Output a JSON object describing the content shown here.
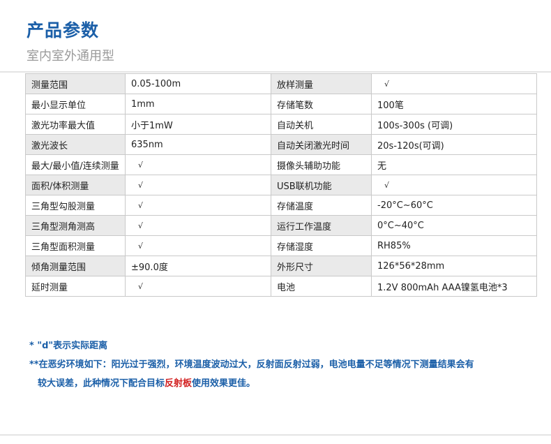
{
  "page": {
    "title": "产品参数",
    "subtitle": "室内室外通用型"
  },
  "spec_rows": [
    {
      "l1": "测量范围",
      "v1": "0.05-100m",
      "l2": "放样测量",
      "v2": "√",
      "shaded": true
    },
    {
      "l1": "最小显示单位",
      "v1": "1mm",
      "l2": "存储笔数",
      "v2": "100笔",
      "shaded": false
    },
    {
      "l1": "激光功率最大值",
      "v1": "小于1mW",
      "l2": "自动关机",
      "v2": "100s-300s (可调)",
      "shaded": false
    },
    {
      "l1": "激光波长",
      "v1": "635nm",
      "l2": "自动关闭激光时间",
      "v2": "20s-120s(可调)",
      "shaded": true
    },
    {
      "l1": "最大/最小值/连续测量",
      "v1": "√",
      "l2": "摄像头辅助功能",
      "v2": "无",
      "shaded": false
    },
    {
      "l1": "面积/体积测量",
      "v1": "√",
      "l2": "USB联机功能",
      "v2": "√",
      "shaded": true
    },
    {
      "l1": "三角型勾股测量",
      "v1": "√",
      "l2": "存储温度",
      "v2": "-20°C~60°C",
      "shaded": false
    },
    {
      "l1": "三角型测角测高",
      "v1": "√",
      "l2": "运行工作温度",
      "v2": "0°C~40°C",
      "shaded": true
    },
    {
      "l1": "三角型面积测量",
      "v1": "√",
      "l2": "存储湿度",
      "v2": "RH85%",
      "shaded": false
    },
    {
      "l1": "倾角测量范围",
      "v1": "±90.0度",
      "l2": "外形尺寸",
      "v2": "126*56*28mm",
      "shaded": true
    },
    {
      "l1": "延时测量",
      "v1": "√",
      "l2": "电池",
      "v2": "1.2V 800mAh  AAA镍氢电池*3",
      "shaded": false
    }
  ],
  "notes": {
    "note1": "* \"d\"表示实际距离",
    "note2_line1": "**在恶劣环境如下：阳光过于强烈，环境温度波动过大，反射面反射过弱，电池电量不足等情况下测量结果会有",
    "note2_line2_pre": "较大误差，此种情况下配合目标",
    "note2_highlight": "反射板",
    "note2_line2_post": "使用效果更佳。"
  },
  "colors": {
    "title": "#1b5fa8",
    "subtitle": "#9a9a9a",
    "label_shade": "#eaeaea",
    "border": "#c9c9c9",
    "note": "#1b5fa8",
    "highlight": "#d22020"
  }
}
